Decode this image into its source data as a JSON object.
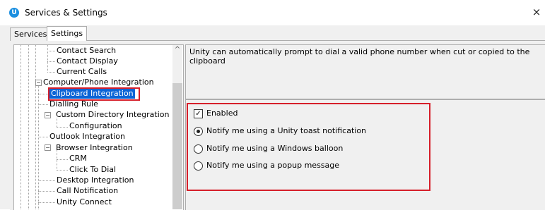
{
  "window": {
    "title": "Services & Settings",
    "logo_letter": "U",
    "close_glyph": "×"
  },
  "tabs": [
    {
      "label": "Services"
    },
    {
      "label": "Settings"
    }
  ],
  "tree": {
    "items": [
      {
        "label": "Contact Search"
      },
      {
        "label": "Contact Display"
      },
      {
        "label": "Current Calls"
      },
      {
        "label": "Computer/Phone Integration"
      },
      {
        "label": "Clipboard Integration"
      },
      {
        "label": "Dialling Rule"
      },
      {
        "label": "Custom Directory Integration"
      },
      {
        "label": "Configuration"
      },
      {
        "label": "Outlook Integration"
      },
      {
        "label": "Browser Integration"
      },
      {
        "label": "CRM"
      },
      {
        "label": "Click To Dial"
      },
      {
        "label": "Desktop Integration"
      },
      {
        "label": "Call Notification"
      },
      {
        "label": "Unity Connect"
      }
    ],
    "selected": "Clipboard Integration",
    "scroll_up_glyph": "^"
  },
  "description": "Unity can automatically prompt to dial a valid phone number when cut or copied to the clipboard",
  "options": {
    "enabled": {
      "label": "Enabled",
      "checked": true,
      "check_glyph": "✓"
    },
    "radios": [
      {
        "label": "Notify me using a Unity toast notification",
        "selected": true
      },
      {
        "label": "Notify me using a Windows balloon",
        "selected": false
      },
      {
        "label": "Notify me using a popup message",
        "selected": false
      }
    ]
  },
  "colors": {
    "highlight_red": "#d61f2a",
    "selection_blue": "#0a64d6",
    "logo_blue": "#1b8fe0"
  }
}
